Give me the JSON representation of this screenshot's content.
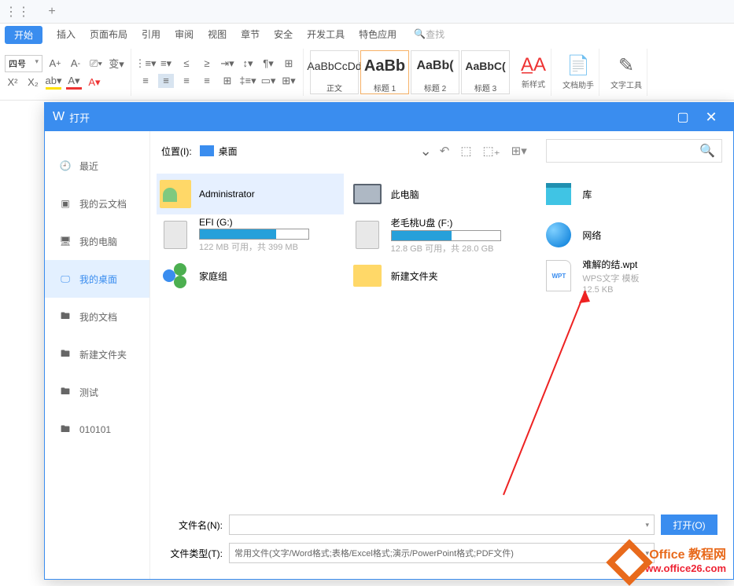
{
  "menu": {
    "start": "开始",
    "items": [
      "插入",
      "页面布局",
      "引用",
      "审阅",
      "视图",
      "章节",
      "安全",
      "开发工具",
      "特色应用"
    ],
    "search": "查找"
  },
  "ribbon": {
    "font_size": "四号",
    "styles": [
      {
        "preview": "AaBbCcDd",
        "name": "正文"
      },
      {
        "preview": "AaBb",
        "name": "标题 1"
      },
      {
        "preview": "AaBb(",
        "name": "标题 2"
      },
      {
        "preview": "AaBbC(",
        "name": "标题 3"
      }
    ],
    "new_style": "新样式",
    "doc_helper": "文档助手",
    "text_tool": "文字工具"
  },
  "dialog": {
    "title": "打开",
    "sidebar": [
      {
        "icon": "clock",
        "label": "最近"
      },
      {
        "icon": "cloud",
        "label": "我的云文档"
      },
      {
        "icon": "pc",
        "label": "我的电脑"
      },
      {
        "icon": "desktop",
        "label": "我的桌面"
      },
      {
        "icon": "folder",
        "label": "我的文档"
      },
      {
        "icon": "folder",
        "label": "新建文件夹"
      },
      {
        "icon": "folder",
        "label": "测试"
      },
      {
        "icon": "folder",
        "label": "010101"
      }
    ],
    "location_label": "位置(I):",
    "location_value": "桌面",
    "files": {
      "admin": "Administrator",
      "thispc": "此电脑",
      "library": "库",
      "efi_name": "EFI (G:)",
      "efi_sub": "122 MB 可用，共 399 MB",
      "usb_name": "老毛桃U盘 (F:)",
      "usb_sub": "12.8 GB 可用，共 28.0 GB",
      "network": "网络",
      "homegroup": "家庭组",
      "newfolder": "新建文件夹",
      "wpt_name": "难解的结.wpt",
      "wpt_sub1": "WPS文字 模板",
      "wpt_sub2": "12.5 KB"
    },
    "filename_label": "文件名(N):",
    "filetype_label": "文件类型(T):",
    "filetype_value": "常用文件(文字/Word格式;表格/Excel格式;演示/PowerPoint格式;PDF文件)",
    "open_btn": "打开(O)"
  },
  "watermark": {
    "line1": "Office 教程网",
    "line2": "www.office26.com"
  }
}
